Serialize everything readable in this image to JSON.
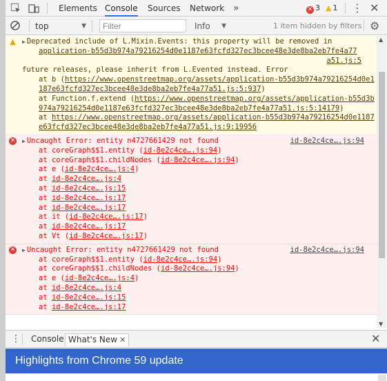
{
  "tabbar": {
    "tabs": [
      "Elements",
      "Console",
      "Sources",
      "Network"
    ],
    "more": "»",
    "errors_count": "3",
    "warnings_count": "1"
  },
  "console_toolbar": {
    "context": "top",
    "filter_placeholder": "Filter",
    "levels": "Info",
    "hidden_note": "1 item hidden by filters"
  },
  "messages": {
    "warning": {
      "l1a": "Deprecated include of L.Mixin.Events: this property will be removed in",
      "l2": "application-b55d3b974a79216254d0e1187e63fcfd327ec3bcee48e3de8ba2eb7fe4a77",
      "l3": "a51.js:5",
      "l4": "future releases, please inherit from L.Evented instead. Error",
      "s1_pre": "at b (",
      "s1_link": "https://www.openstreetmap.org/assets/application-b55d3b974a79216254d0e1187e63fcfd327ec3bcee48e3de8ba2eb7fe4a77a51.js:5:937",
      "s1_post": ")",
      "s2_pre": "at Function.f.extend (",
      "s2_link": "https://www.openstreetmap.org/assets/application-b55d3b974a79216254d0e1187e63fcfd327ec3bcee48e3de8ba2eb7fe4a77a51.js:5:14179",
      "s2_post": ")",
      "s3_pre": "at ",
      "s3_link": "https://www.openstreetmap.org/assets/application-b55d3b974a79216254d0e1187e63fcfd327ec3bcee48e3de8ba2eb7fe4a77a51.js:9:19956"
    },
    "error1": {
      "text": "Uncaught Error: entity n4727661429 not found",
      "src": "id-8e2c4ce….js:94",
      "frames": [
        {
          "pre": "at coreGraph$$1.entity (",
          "link": "id-8e2c4ce….js:94",
          "post": ")"
        },
        {
          "pre": "at coreGraph$$1.childNodes (",
          "link": "id-8e2c4ce….js:94",
          "post": ")"
        },
        {
          "pre": "at e (",
          "link": "id-8e2c4ce….js:4",
          "post": ")"
        },
        {
          "pre": "at ",
          "link": "id-8e2c4ce….js:4",
          "post": ""
        },
        {
          "pre": "at ",
          "link": "id-8e2c4ce….js:15",
          "post": ""
        },
        {
          "pre": "at ",
          "link": "id-8e2c4ce….js:17",
          "post": ""
        },
        {
          "pre": "at ",
          "link": "id-8e2c4ce….js:17",
          "post": ""
        },
        {
          "pre": "at it (",
          "link": "id-8e2c4ce….js:17",
          "post": ")"
        },
        {
          "pre": "at ",
          "link": "id-8e2c4ce….js:17",
          "post": ""
        },
        {
          "pre": "at Vt (",
          "link": "id-8e2c4ce….js:17",
          "post": ")"
        }
      ]
    },
    "error2": {
      "text": "Uncaught Error: entity n4727661429 not found",
      "src": "id-8e2c4ce….js:94",
      "frames": [
        {
          "pre": "at coreGraph$$1.entity (",
          "link": "id-8e2c4ce….js:94",
          "post": ")"
        },
        {
          "pre": "at coreGraph$$1.childNodes (",
          "link": "id-8e2c4ce….js:94",
          "post": ")"
        },
        {
          "pre": "at e (",
          "link": "id-8e2c4ce….js:4",
          "post": ")"
        },
        {
          "pre": "at ",
          "link": "id-8e2c4ce….js:4",
          "post": ""
        },
        {
          "pre": "at ",
          "link": "id-8e2c4ce….js:15",
          "post": ""
        },
        {
          "pre": "at ",
          "link": "id-8e2c4ce….js:17",
          "post": ""
        }
      ]
    }
  },
  "drawer": {
    "tabs": [
      "Console",
      "What's New"
    ],
    "banner": "Highlights from Chrome 59 update"
  },
  "colors": {
    "accent": "#1a73e8",
    "error": "#ff0000",
    "banner": "#3366cc"
  }
}
